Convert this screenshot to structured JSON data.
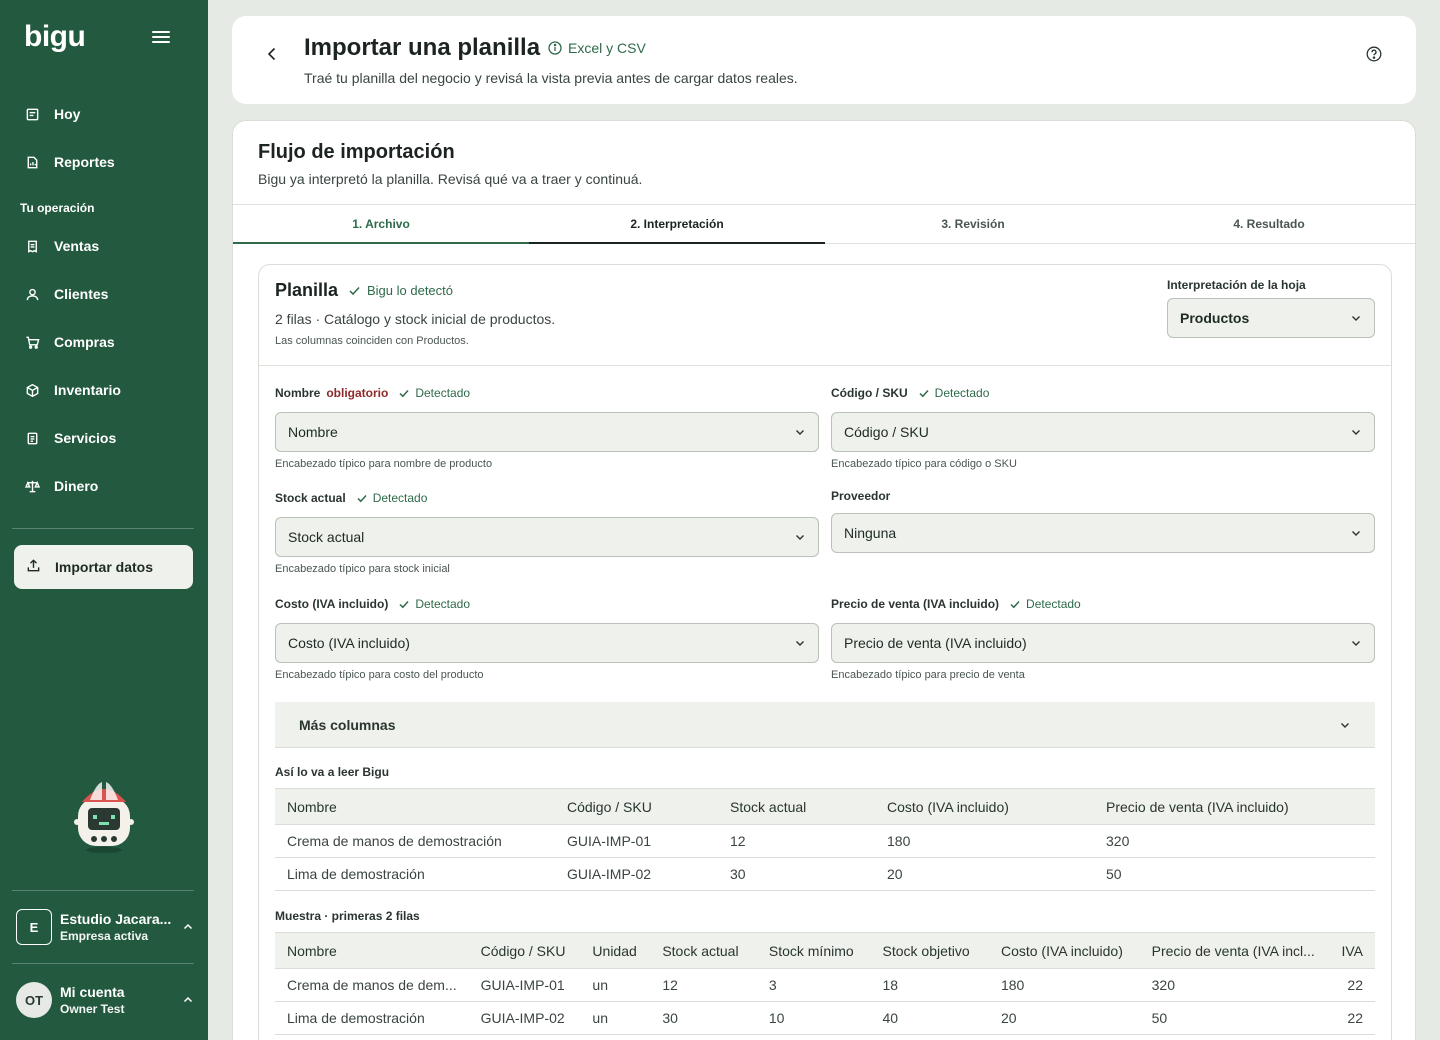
{
  "app": {
    "logo": "bigu"
  },
  "sidebar": {
    "top_items": [
      {
        "label": "Hoy",
        "icon": "calendar-icon"
      },
      {
        "label": "Reportes",
        "icon": "report-icon"
      }
    ],
    "section_label": "Tu operación",
    "items": [
      {
        "label": "Ventas",
        "icon": "receipt-icon"
      },
      {
        "label": "Clientes",
        "icon": "user-icon"
      },
      {
        "label": "Compras",
        "icon": "cart-icon"
      },
      {
        "label": "Inventario",
        "icon": "box-icon"
      },
      {
        "label": "Servicios",
        "icon": "document-icon"
      },
      {
        "label": "Dinero",
        "icon": "scale-icon"
      }
    ],
    "import_button": {
      "label": "Importar datos",
      "icon": "upload-icon"
    },
    "business": {
      "badge": "E",
      "name": "Estudio Jacara...",
      "sub": "Empresa activa"
    },
    "user": {
      "badge": "OT",
      "name": "Mi cuenta",
      "sub": "Owner Test"
    }
  },
  "header": {
    "title": "Importar una planilla",
    "format": "Excel y CSV",
    "subtitle": "Traé tu planilla del negocio y revisá la vista previa antes de cargar datos reales."
  },
  "flow": {
    "title": "Flujo de importación",
    "subtitle": "Bigu ya interpretó la planilla. Revisá qué va a traer y continuá.",
    "steps": [
      "1. Archivo",
      "2. Interpretación",
      "3. Revisión",
      "4. Resultado"
    ]
  },
  "sheet": {
    "title": "Planilla",
    "detected_label": "Bigu lo detectó",
    "meta": "2 filas · Catálogo y stock inicial de productos.",
    "note": "Las columnas coinciden con Productos.",
    "interpretation_label": "Interpretación de la hoja",
    "interpretation_value": "Productos"
  },
  "fields": {
    "nombre": {
      "label": "Nombre",
      "required": "obligatorio",
      "detected": "Detectado",
      "value": "Nombre",
      "help": "Encabezado típico para nombre de producto"
    },
    "codigo": {
      "label": "Código / SKU",
      "detected": "Detectado",
      "value": "Código / SKU",
      "help": "Encabezado típico para código o SKU"
    },
    "stock": {
      "label": "Stock actual",
      "detected": "Detectado",
      "value": "Stock actual",
      "help": "Encabezado típico para stock inicial"
    },
    "proveedor": {
      "label": "Proveedor",
      "value": "Ninguna"
    },
    "costo": {
      "label": "Costo (IVA incluido)",
      "detected": "Detectado",
      "value": "Costo (IVA incluido)",
      "help": "Encabezado típico para costo del producto"
    },
    "precio": {
      "label": "Precio de venta (IVA incluido)",
      "detected": "Detectado",
      "value": "Precio de venta (IVA incluido)",
      "help": "Encabezado típico para precio de venta"
    }
  },
  "more_columns": "Más columnas",
  "preview": {
    "caption": "Así lo va a leer Bigu",
    "headers": [
      "Nombre",
      "Código / SKU",
      "Stock actual",
      "Costo (IVA incluido)",
      "Precio de venta (IVA incluido)"
    ],
    "rows": [
      [
        "Crema de manos de demostración",
        "GUIA-IMP-01",
        "12",
        "180",
        "320"
      ],
      [
        "Lima de demostración",
        "GUIA-IMP-02",
        "30",
        "20",
        "50"
      ]
    ]
  },
  "sample": {
    "caption": "Muestra · primeras 2 filas",
    "headers": [
      "Nombre",
      "Código / SKU",
      "Unidad",
      "Stock actual",
      "Stock mínimo",
      "Stock objetivo",
      "Costo (IVA incluido)",
      "Precio de venta (IVA incl...",
      "IVA"
    ],
    "rows": [
      [
        "Crema de manos de dem...",
        "GUIA-IMP-01",
        "un",
        "12",
        "3",
        "18",
        "180",
        "320",
        "22"
      ],
      [
        "Lima de demostración",
        "GUIA-IMP-02",
        "un",
        "30",
        "10",
        "40",
        "20",
        "50",
        "22"
      ]
    ]
  }
}
